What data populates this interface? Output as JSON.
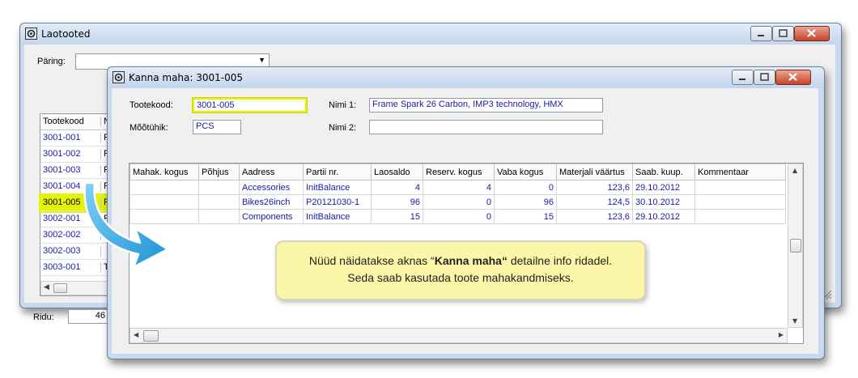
{
  "back_window": {
    "title": "Laotooted",
    "query_label": "Päring:",
    "column_header": "Tootekood",
    "column_header2": "N",
    "items": [
      {
        "code": "3001-001",
        "col2": "F"
      },
      {
        "code": "3001-002",
        "col2": "F"
      },
      {
        "code": "3001-003",
        "col2": "F"
      },
      {
        "code": "3001-004",
        "col2": "F"
      },
      {
        "code": "3001-005",
        "col2": "F"
      },
      {
        "code": "3002-001",
        "col2": "F"
      },
      {
        "code": "3002-002",
        "col2": "F"
      },
      {
        "code": "3002-003",
        "col2": ""
      },
      {
        "code": "3003-001",
        "col2": "T"
      }
    ],
    "selected_index": 4,
    "rows_label": "Ridu:",
    "rows_count": "46"
  },
  "front_window": {
    "title": "Kanna maha: 3001-005",
    "product_code_label": "Tootekood:",
    "product_code_value": "3001-005",
    "unit_label": "Mõõtühik:",
    "unit_value": "PCS",
    "name1_label": "Nimi 1:",
    "name1_value": "Frame Spark 26 Carbon, IMP3 technology, HMX",
    "name2_label": "Nimi 2:",
    "name2_value": "",
    "grid": {
      "columns": [
        "Mahak. kogus",
        "Põhjus",
        "Aadress",
        "Partii nr.",
        "Laosaldo",
        "Reserv. kogus",
        "Vaba kogus",
        "Materjali väärtus",
        "Saab. kuup.",
        "Kommentaar"
      ],
      "rows": [
        {
          "mahak_kogus": "",
          "pohjus": "",
          "aadress": "Accessories",
          "partii": "InitBalance",
          "laosaldo": "4",
          "reserv": "4",
          "vaba": "0",
          "vaartus": "123,6",
          "saab": "29.10.2012",
          "kommentaar": ""
        },
        {
          "mahak_kogus": "",
          "pohjus": "",
          "aadress": "Bikes26inch",
          "partii": "P20121030-1",
          "laosaldo": "96",
          "reserv": "0",
          "vaba": "96",
          "vaartus": "124,5",
          "saab": "30.10.2012",
          "kommentaar": ""
        },
        {
          "mahak_kogus": "",
          "pohjus": "",
          "aadress": "Components",
          "partii": "InitBalance",
          "laosaldo": "15",
          "reserv": "0",
          "vaba": "15",
          "vaartus": "123,6",
          "saab": "29.10.2012",
          "kommentaar": ""
        }
      ]
    }
  },
  "callout": {
    "line1_prefix": "Nüüd näidatakse aknas “",
    "line1_bold": "Kanna maha“",
    "line1_suffix": " detailne info ridadel.",
    "line2": "Seda saab kasutada toote mahakandmiseks."
  },
  "colors": {
    "link_text": "#1a1aa6",
    "highlight": "#e6f20a",
    "callout_bg": "#fbf6a8",
    "arrow": "#2aa8e8"
  }
}
